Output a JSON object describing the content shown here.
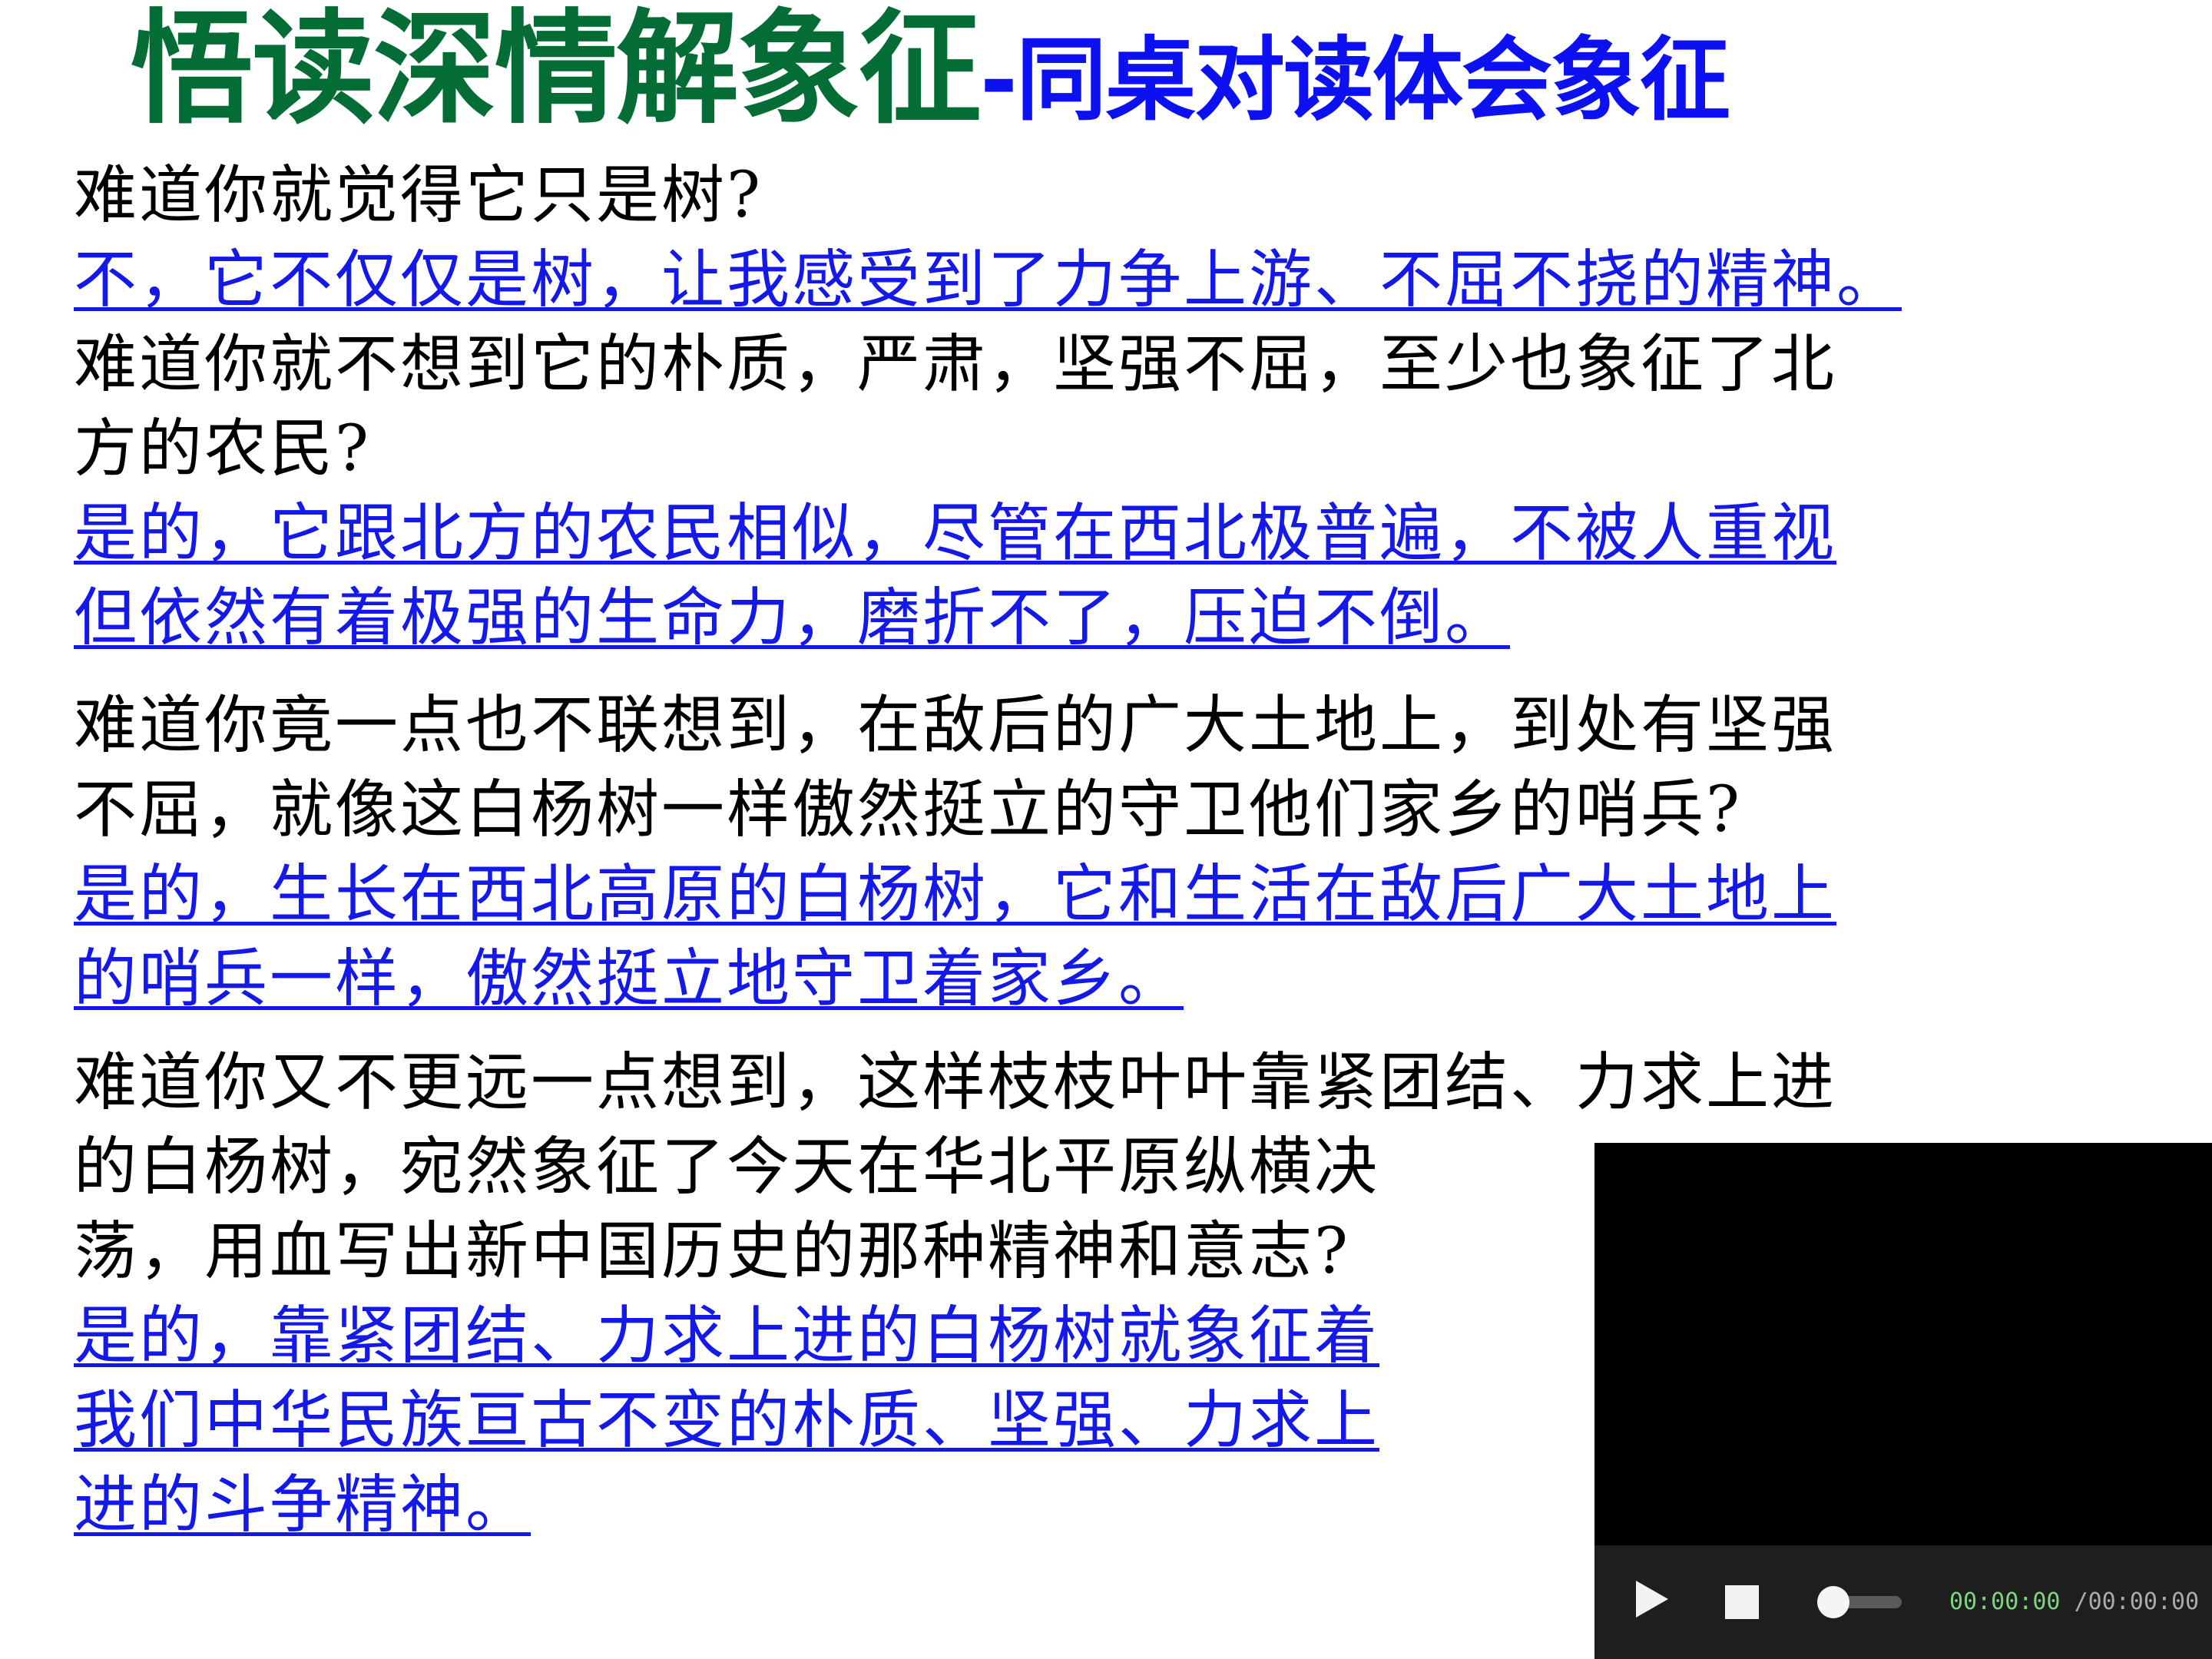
{
  "title": {
    "main": "悟读深情解象征",
    "sub": "-同桌对读体会象征"
  },
  "qa": [
    {
      "question": [
        "难道你就觉得它只是树?"
      ],
      "answer": [
        "不，它不仅仅是树，让我感受到了力争上游、不屈不挠的精神。"
      ]
    },
    {
      "question": [
        "难道你就不想到它的朴质，严肃，坚强不屈，至少也象征了北",
        "方的农民?"
      ],
      "answer": [
        "是的，它跟北方的农民相似，尽管在西北极普遍，不被人重视",
        "但依然有着极强的生命力，磨折不了，压迫不倒。"
      ]
    },
    {
      "question": [
        "难道你竟一点也不联想到，在敌后的广大土地上，到处有坚强",
        "不屈，就像这白杨树一样傲然挺立的守卫他们家乡的哨兵?"
      ],
      "answer": [
        "是的，生长在西北高原的白杨树，它和生活在敌后广大土地上",
        "的哨兵一样，傲然挺立地守卫着家乡。"
      ]
    },
    {
      "question": [
        "难道你又不更远一点想到，这样枝枝叶叶靠紧团结、力求上进",
        "的白杨树，宛然象征了今天在华北平原纵横决",
        "荡，用血写出新中国历史的那种精神和意志?"
      ],
      "answer": [
        "是的，靠紧团结、力求上进的白杨树就象征着",
        "我们中华民族亘古不变的朴质、坚强、力求上",
        "进的斗争精神。"
      ]
    }
  ],
  "video": {
    "current_time": "00:00:00",
    "separator": "/",
    "total_time": "00:00:00",
    "progress": 0
  },
  "colors": {
    "title_main": "#046d36",
    "title_sub": "#0d10f0",
    "answer": "#1418e8",
    "question": "#000000"
  }
}
